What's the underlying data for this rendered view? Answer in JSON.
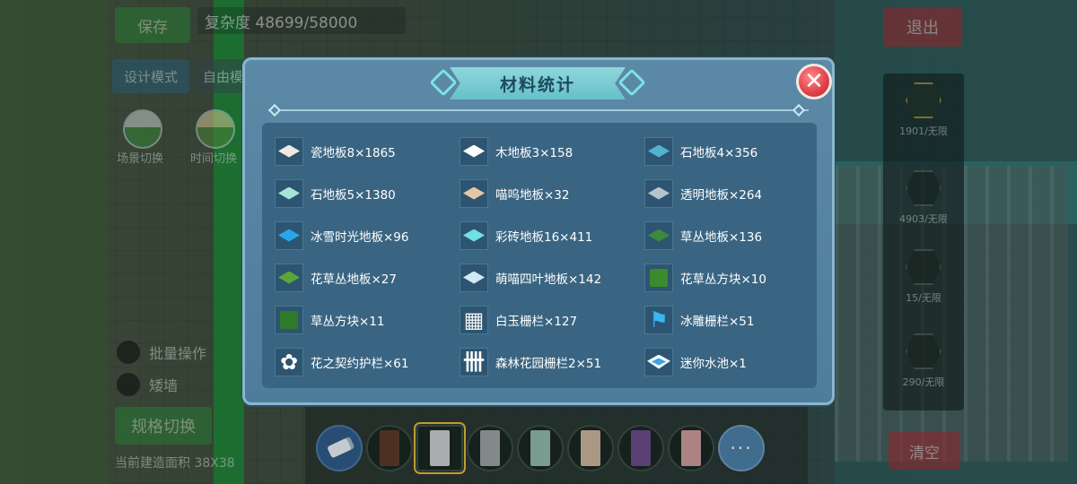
{
  "hud": {
    "save_label": "保存",
    "complexity_text": "复杂度 48699/58000",
    "mode_design_label": "设计模式",
    "mode_free_label": "自由模",
    "scene_switch_label": "场景切换",
    "time_switch_label": "时间切换",
    "batch_op_label": "批量操作",
    "wall_label": "矮墙",
    "spec_switch_label": "规格切换",
    "build_area_text": "当前建造面积 38X38",
    "exit_label": "退出",
    "clear_label": "清空"
  },
  "side_panel": {
    "items": [
      {
        "count": "1901/无限",
        "icon": "floor-tile-icon"
      },
      {
        "count": "4903/无限",
        "icon": "wall-block-icon"
      },
      {
        "count": "15/无限",
        "icon": "window-icon"
      },
      {
        "count": "290/无限",
        "icon": "stairs-icon"
      }
    ]
  },
  "hotbar": {
    "more_label": "···",
    "slots": [
      {
        "icon": "eraser-icon"
      },
      {
        "icon": "wood-pillar-icon",
        "color": "#5a3a2a"
      },
      {
        "icon": "white-pillar-icon",
        "color": "#c8cccc"
      },
      {
        "icon": "grey-pillar-icon",
        "color": "#9aa0a0"
      },
      {
        "icon": "mint-pillar-icon",
        "color": "#8fb8a8"
      },
      {
        "icon": "beige-pillar-icon",
        "color": "#c9b39a"
      },
      {
        "icon": "purple-pillar-icon",
        "color": "#6a4a8a"
      },
      {
        "icon": "pink-pillar-icon",
        "color": "#c99a9a"
      }
    ]
  },
  "dialog": {
    "title": "材料统计",
    "close_symbol": "✕",
    "materials": [
      {
        "label": "瓷地板8×1865",
        "icon": "porcelain-floor-icon",
        "kind": "tile",
        "color": "#f2e8e2"
      },
      {
        "label": "木地板3×158",
        "icon": "wood-floor-icon",
        "kind": "tile",
        "color": "#ffffff"
      },
      {
        "label": "石地板4×356",
        "icon": "stone-floor-icon",
        "kind": "tile",
        "color": "#4fb3cf"
      },
      {
        "label": "石地板5×1380",
        "icon": "stone-floor-icon",
        "kind": "tile",
        "color": "#a6e6d6"
      },
      {
        "label": "喵呜地板×32",
        "icon": "meow-floor-icon",
        "kind": "tile",
        "color": "#e6c6a6"
      },
      {
        "label": "透明地板×264",
        "icon": "glass-floor-icon",
        "kind": "tile",
        "color": "#b6c4cc"
      },
      {
        "label": "冰雪时光地板×96",
        "icon": "ice-floor-icon",
        "kind": "tile",
        "color": "#2aa6e6"
      },
      {
        "label": "彩砖地板16×411",
        "icon": "color-brick-floor-icon",
        "kind": "tile",
        "color": "#6ee0e6"
      },
      {
        "label": "草丛地板×136",
        "icon": "grass-floor-icon",
        "kind": "tile",
        "color": "#3f8a3a"
      },
      {
        "label": "花草丛地板×27",
        "icon": "flower-grass-floor-icon",
        "kind": "tile",
        "color": "#5aa63a"
      },
      {
        "label": "萌喵四叶地板×142",
        "icon": "clover-floor-icon",
        "kind": "tile",
        "color": "#cfeaf2"
      },
      {
        "label": "花草丛方块×10",
        "icon": "flower-grass-block-icon",
        "kind": "block",
        "color": "#3a8a2e"
      },
      {
        "label": "草丛方块×11",
        "icon": "grass-block-icon",
        "kind": "block",
        "color": "#2e7a2a"
      },
      {
        "label": "白玉栅栏×127",
        "icon": "jade-fence-icon",
        "kind": "glyph",
        "glyph": "▦",
        "color": "#f2f2f2"
      },
      {
        "label": "冰雕栅栏×51",
        "icon": "ice-fence-icon",
        "kind": "glyph",
        "glyph": "⚑",
        "color": "#3ab6f2"
      },
      {
        "label": "花之契约护栏×61",
        "icon": "flower-railing-icon",
        "kind": "glyph",
        "glyph": "✿",
        "color": "#ffffff"
      },
      {
        "label": "森林花园栅栏2×51",
        "icon": "forest-fence-icon",
        "kind": "glyph",
        "glyph": "卌",
        "color": "#ffffff"
      },
      {
        "label": "迷你水池×1",
        "icon": "mini-pool-icon",
        "kind": "pool",
        "color": "#3aa3e6"
      }
    ]
  }
}
